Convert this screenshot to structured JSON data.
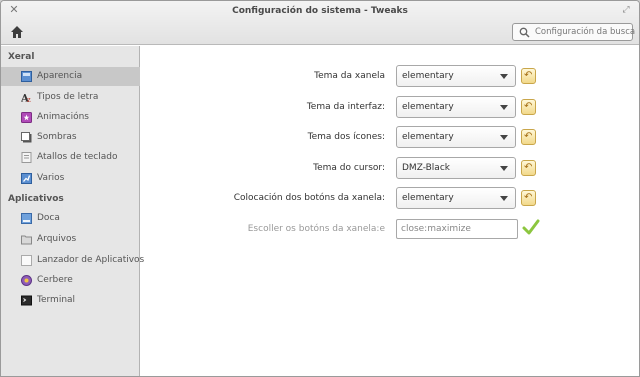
{
  "window": {
    "title": "Configuración do sistema - Tweaks",
    "search_placeholder": "Configuración da busca"
  },
  "sidebar": {
    "categories": [
      {
        "label": "Xeral",
        "items": [
          {
            "label": "Aparencia",
            "icon": "appearance-icon",
            "selected": true
          },
          {
            "label": "Tipos de letra",
            "icon": "fonts-icon"
          },
          {
            "label": "Animacións",
            "icon": "animations-icon"
          },
          {
            "label": "Sombras",
            "icon": "shadows-icon"
          },
          {
            "label": "Atallos de teclado",
            "icon": "keyboard-icon"
          },
          {
            "label": "Varios",
            "icon": "misc-icon"
          }
        ]
      },
      {
        "label": "Aplicativos",
        "items": [
          {
            "label": "Doca",
            "icon": "dock-icon"
          },
          {
            "label": "Arquivos",
            "icon": "files-icon"
          },
          {
            "label": "Lanzador de Aplicativos",
            "icon": "launcher-icon"
          },
          {
            "label": "Cerbere",
            "icon": "cerbere-icon"
          },
          {
            "label": "Terminal",
            "icon": "terminal-icon"
          }
        ]
      }
    ]
  },
  "settings": [
    {
      "label": "Tema da xanela",
      "value": "elementary"
    },
    {
      "label": "Tema da interfaz:",
      "value": "elementary"
    },
    {
      "label": "Tema dos ícones:",
      "value": "elementary"
    },
    {
      "label": "Tema do cursor:",
      "value": "DMZ-Black"
    },
    {
      "label": "Colocación dos botóns da xanela:",
      "value": "elementary"
    }
  ],
  "custom_buttons": {
    "label": "Escoller os botóns da xanela:e",
    "value": "close:maximize"
  },
  "colors": {
    "sidebar_bg": "#e6e6e6",
    "selected_bg": "#c8c8c8",
    "reset_accent": "#f2d88a",
    "check_green": "#8cc63f"
  }
}
